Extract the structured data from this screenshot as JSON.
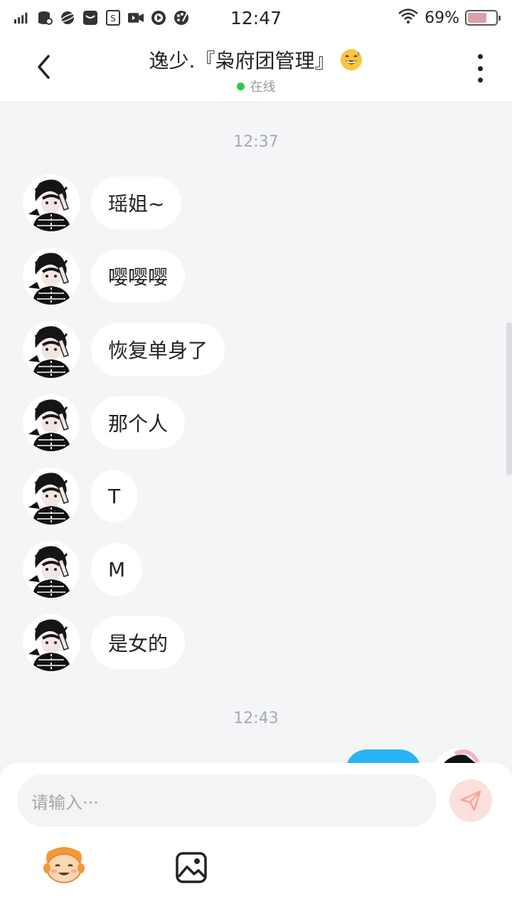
{
  "status_bar": {
    "time": "12:47",
    "battery_percent_text": "69%",
    "battery_level": 0.69
  },
  "header": {
    "title": "逸少.『枭府团管理』",
    "status": "在线"
  },
  "chat": {
    "timestamps": [
      "12:37",
      "12:43"
    ],
    "messages": [
      {
        "text": "瑶姐~"
      },
      {
        "text": "嘤嘤嘤"
      },
      {
        "text": "恢复单身了"
      },
      {
        "text": "那个人"
      },
      {
        "text": "T"
      },
      {
        "text": "M"
      },
      {
        "text": "是女的"
      }
    ]
  },
  "input": {
    "placeholder": "请输入···"
  },
  "icons": {
    "signal": "signal-icon",
    "wifi": "wifi-icon",
    "back": "back-arrow-icon",
    "more": "more-vertical-icon",
    "send": "send-icon",
    "emoji": "emoji-icon",
    "image": "image-icon"
  },
  "colors": {
    "online": "#2bc84a",
    "sent_bubble": "#2ab4f5",
    "send_button": "#fbe0de",
    "send_icon": "#f6a59a",
    "background": "#f4f5f7"
  }
}
